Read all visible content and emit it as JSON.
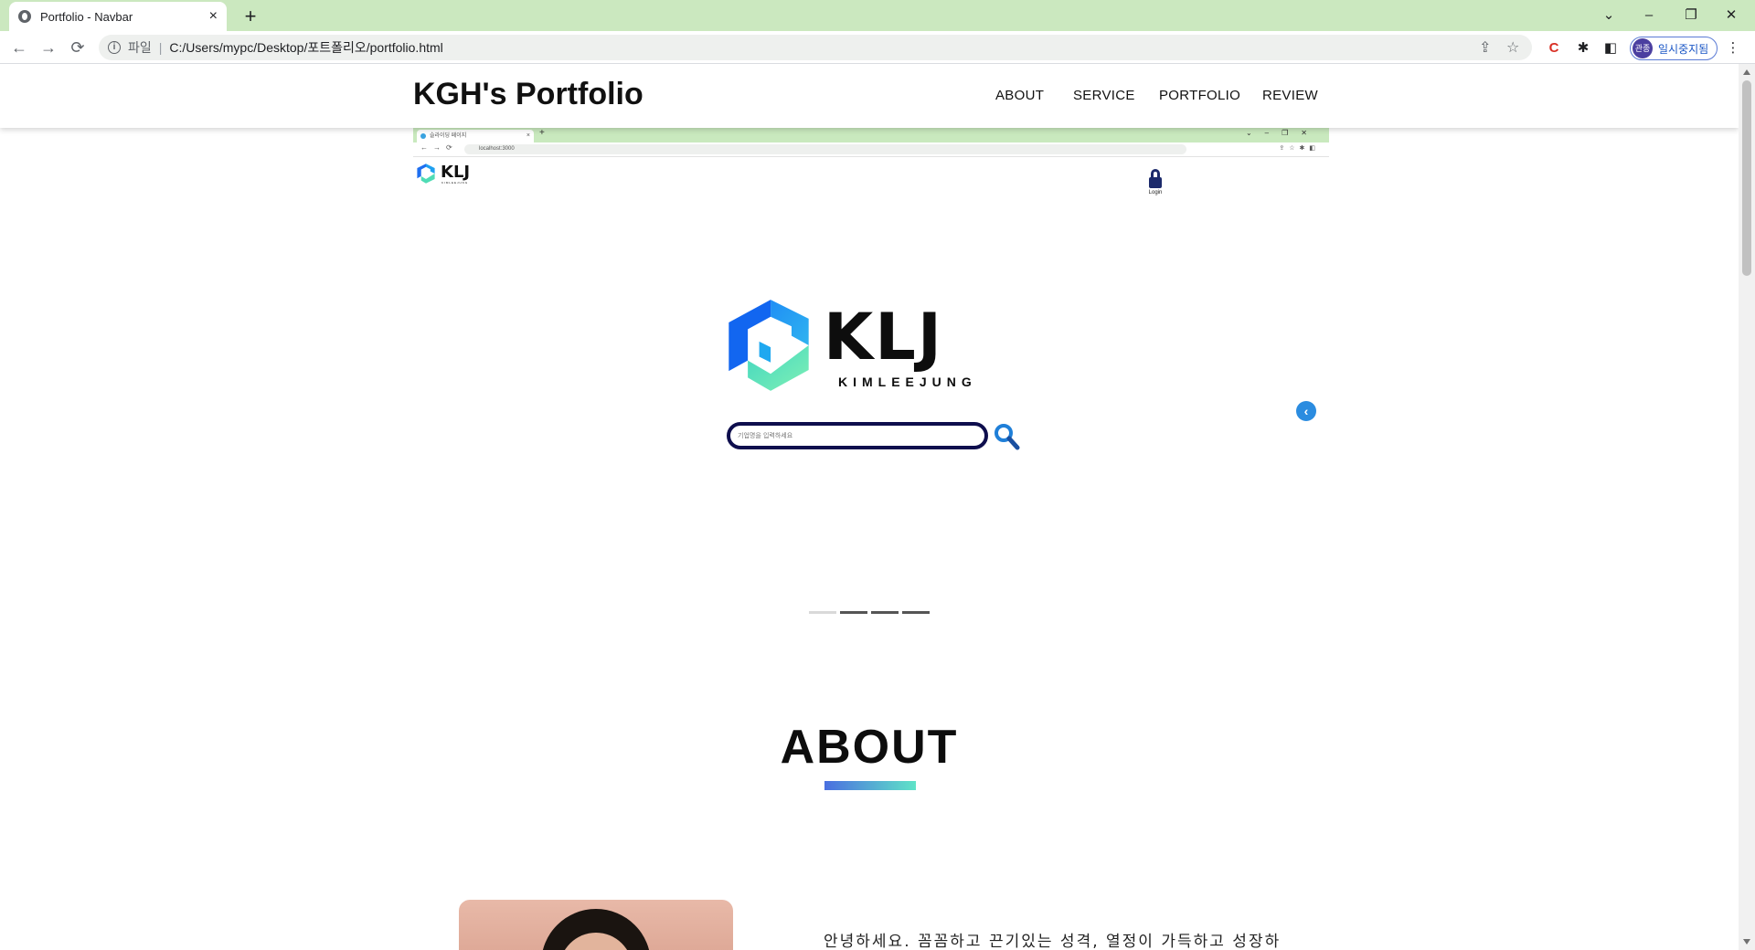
{
  "browser": {
    "tab_title": "Portfolio - Navbar",
    "tab_close": "×",
    "new_tab": "+",
    "window_controls": {
      "list": "⌄",
      "minimize": "–",
      "restore": "❐",
      "close": "✕"
    },
    "url_scheme": "파일",
    "url_separator": "|",
    "url": "C:/Users/mypc/Desktop/포트폴리오/portfolio.html",
    "profile_avatar": "관종",
    "profile_label": "일시중지됨"
  },
  "site": {
    "brand": "KGH's Portfolio",
    "menu": [
      "ABOUT",
      "SERVICE",
      "PORTFOLIO",
      "REVIEW"
    ]
  },
  "slide": {
    "mini_tab_title": "슬라이딩 페이지",
    "mini_url": "localhost:3000",
    "mini_logo": "KLJ",
    "mini_logo_sub": "KIMLEEJUNG",
    "login_label": "Login",
    "logo_word": "KLJ",
    "logo_sub": "KIMLEEJUNG",
    "search_placeholder": "기업명을 입력하세요",
    "indicator_count": 4,
    "active_indicator": 0
  },
  "about": {
    "title": "ABOUT",
    "intro": "안녕하세요. 꼼꼼하고 끈기있는 성격, 열정이 가득하고 성장하"
  },
  "colors": {
    "tabbar": "#cbe8bf",
    "accent_gradient_start": "#4a6fe0",
    "accent_gradient_end": "#5fe3c7",
    "search_border": "#0e0e4d"
  }
}
